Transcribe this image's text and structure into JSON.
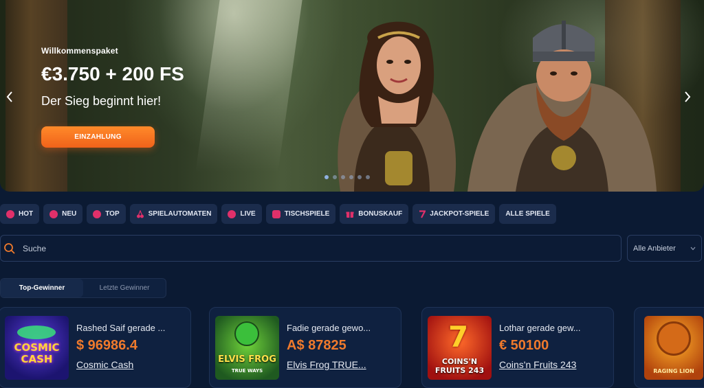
{
  "hero": {
    "subtitle": "Willkommenspaket",
    "title": "€3.750 + 200 FS",
    "tagline": "Der Sieg beginnt hier!",
    "cta_label": "EINZAHLUNG"
  },
  "categories": [
    {
      "label": "HOT",
      "icon": "fire-icon"
    },
    {
      "label": "NEU",
      "icon": "new-icon"
    },
    {
      "label": "TOP",
      "icon": "top-icon"
    },
    {
      "label": "SPIELAUTOMATEN",
      "icon": "cherries-icon"
    },
    {
      "label": "LIVE",
      "icon": "live-icon"
    },
    {
      "label": "TISCHSPIELE",
      "icon": "table-games-icon"
    },
    {
      "label": "BONUSKAUF",
      "icon": "gift-icon"
    },
    {
      "label": "JACKPOT-SPIELE",
      "icon": "seven-icon"
    },
    {
      "label": "ALLE SPIELE",
      "icon": ""
    }
  ],
  "search": {
    "placeholder": "Suche"
  },
  "provider_select": {
    "value": "Alle Anbieter"
  },
  "winner_tabs": {
    "top": "Top-Gewinner",
    "latest": "Letzte Gewinner"
  },
  "winners": [
    {
      "who": "Rashed Saif gerade ...",
      "amount": "$ 96986.4",
      "game": "Cosmic Cash",
      "thumb_text": "COSMIC CASH"
    },
    {
      "who": "Fadie gerade gewo...",
      "amount": "A$ 87825",
      "game": "Elvis Frog TRUE...",
      "thumb_text": "ELVIS FROG",
      "thumb_sub": "TRUE WAYS"
    },
    {
      "who": "Lothar gerade gew...",
      "amount": "€ 50100",
      "game": "Coins'n Fruits 243",
      "thumb_text": "COINS'N FRUITS 243"
    },
    {
      "thumb_text": "RAGING LION"
    }
  ],
  "colors": {
    "accent": "#f07a2c",
    "category_icon": "#e0306a",
    "background": "#0b1a33"
  }
}
